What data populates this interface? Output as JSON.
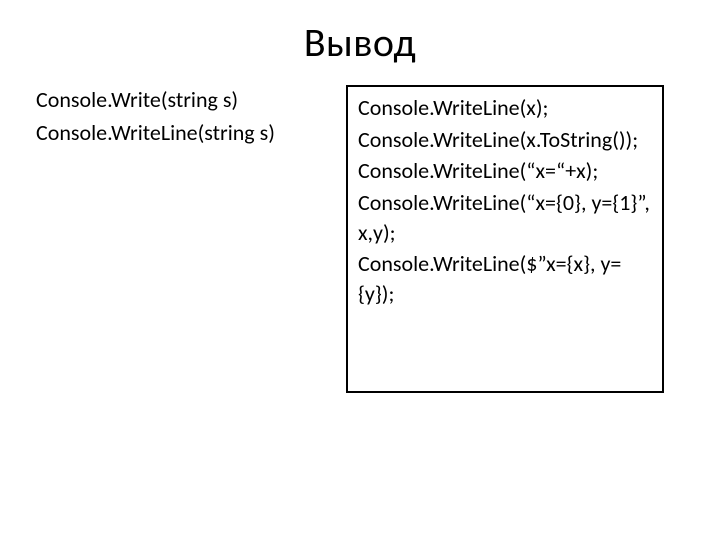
{
  "title": "Вывод",
  "left": {
    "line1": "Console.Write(string s)",
    "line2": "Console.WriteLine(string s)"
  },
  "right": {
    "line1": "Console.WriteLine(x);",
    "line2": "Console.WriteLine(x.ToString());",
    "line3": "Console.WriteLine(“x=“+x);",
    "line4": "Console.WriteLine(“x={0}, y={1}”, x,y);",
    "line5": "Console.WriteLine($”x={x}, y={y});"
  }
}
